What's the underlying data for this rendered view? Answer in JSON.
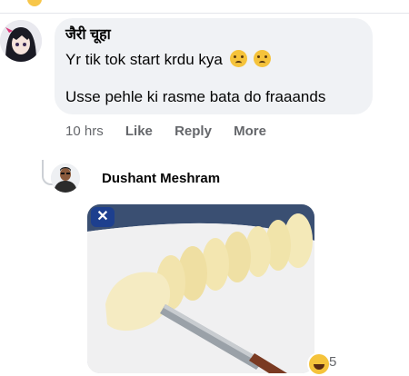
{
  "comment": {
    "author": "जैरी चूहा",
    "line1": "Yr tik tok start krdu kya",
    "line2": "Usse pehle ki rasme bata do fraaands",
    "time": "10 hrs",
    "like_label": "Like",
    "reply_label": "Reply",
    "more_label": "More"
  },
  "reply": {
    "author": "Dushant Meshram",
    "close_glyph": "✕",
    "reaction_count": "5"
  },
  "colors": {
    "bubble": "#f0f2f5",
    "meta_text": "#65676b",
    "close_badge": "#1d3f8e"
  },
  "icons": [
    "sad-emoji-icon",
    "close-icon",
    "laughing-emoji-icon"
  ]
}
